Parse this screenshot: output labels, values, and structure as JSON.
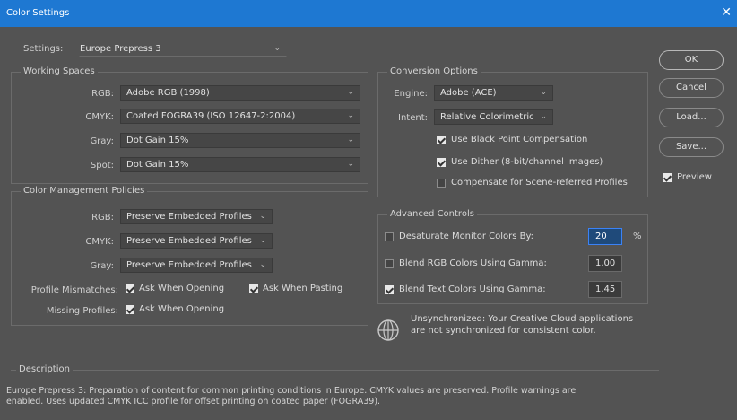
{
  "window": {
    "title": "Color Settings",
    "close": "✕"
  },
  "settings": {
    "label": "Settings:",
    "value": "Europe Prepress 3"
  },
  "working_spaces": {
    "legend": "Working Spaces",
    "rows": [
      {
        "label": "RGB:",
        "value": "Adobe RGB (1998)"
      },
      {
        "label": "CMYK:",
        "value": "Coated FOGRA39 (ISO 12647-2:2004)"
      },
      {
        "label": "Gray:",
        "value": "Dot Gain 15%"
      },
      {
        "label": "Spot:",
        "value": "Dot Gain 15%"
      }
    ]
  },
  "policies": {
    "legend": "Color Management Policies",
    "rows": [
      {
        "label": "RGB:",
        "value": "Preserve Embedded Profiles"
      },
      {
        "label": "CMYK:",
        "value": "Preserve Embedded Profiles"
      },
      {
        "label": "Gray:",
        "value": "Preserve Embedded Profiles"
      }
    ],
    "mismatch_label": "Profile Mismatches:",
    "ask_opening": "Ask When Opening",
    "ask_pasting": "Ask When Pasting",
    "missing_label": "Missing Profiles:",
    "missing_ask": "Ask When Opening"
  },
  "conversion": {
    "legend": "Conversion Options",
    "engine_label": "Engine:",
    "engine_value": "Adobe (ACE)",
    "intent_label": "Intent:",
    "intent_value": "Relative Colorimetric",
    "black_point": "Use Black Point Compensation",
    "dither": "Use Dither (8-bit/channel images)",
    "scene": "Compensate for Scene-referred Profiles"
  },
  "advanced": {
    "legend": "Advanced Controls",
    "desaturate": "Desaturate Monitor Colors By:",
    "desaturate_value": "20",
    "percent": "%",
    "blend_rgb": "Blend RGB Colors Using Gamma:",
    "blend_rgb_value": "1.00",
    "blend_text": "Blend Text Colors Using Gamma:",
    "blend_text_value": "1.45"
  },
  "sync": {
    "line1": "Unsynchronized: Your Creative Cloud applications",
    "line2": "are not synchronized for consistent color."
  },
  "description": {
    "legend": "Description",
    "line1": "Europe Prepress 3:  Preparation of content for common printing conditions in Europe. CMYK values are preserved. Profile warnings are",
    "line2": "enabled. Uses updated CMYK ICC profile for offset printing on coated paper (FOGRA39)."
  },
  "buttons": {
    "ok": "OK",
    "cancel": "Cancel",
    "load": "Load...",
    "save": "Save...",
    "preview": "Preview"
  }
}
